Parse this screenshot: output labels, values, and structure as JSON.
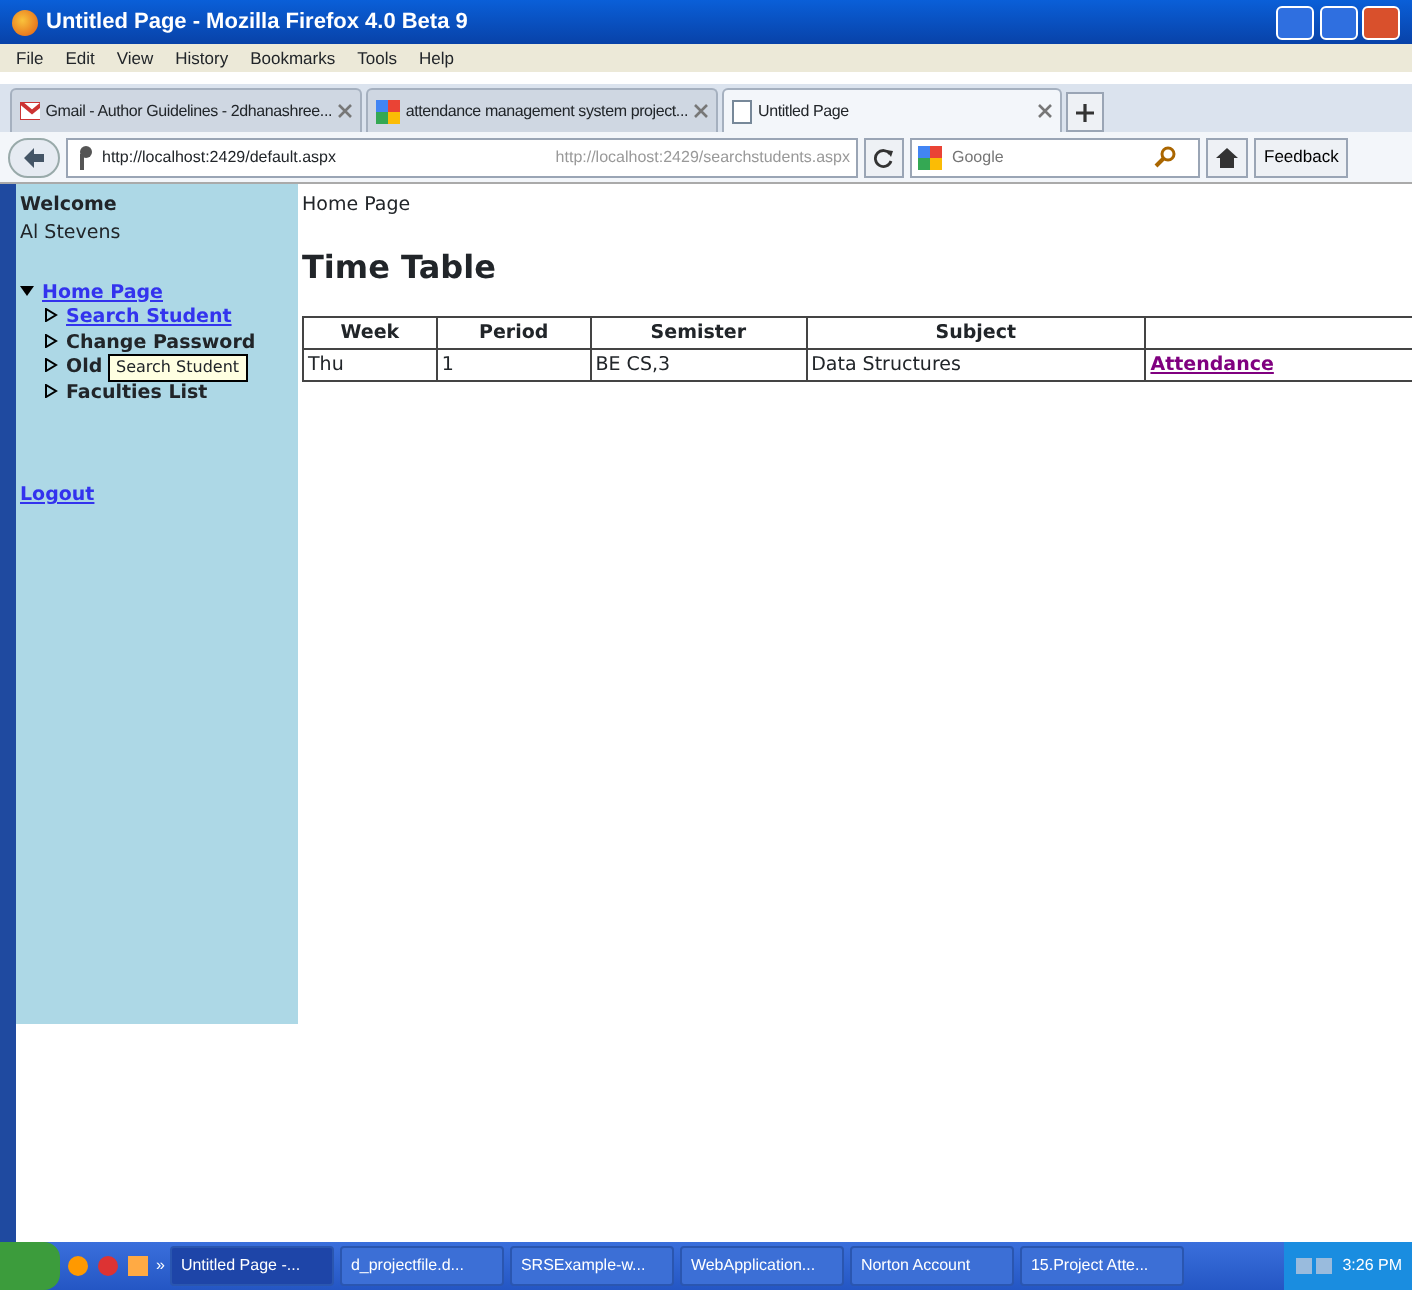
{
  "window": {
    "title": "Untitled Page - Mozilla Firefox 4.0 Beta 9"
  },
  "menu": [
    "File",
    "Edit",
    "View",
    "History",
    "Bookmarks",
    "Tools",
    "Help"
  ],
  "tabs": [
    {
      "label": "Gmail - Author Guidelines - 2dhanashree...",
      "selected": false
    },
    {
      "label": "attendance management system project...",
      "selected": false
    },
    {
      "label": "Untitled Page",
      "selected": true
    }
  ],
  "navbar": {
    "url": "http://localhost:2429/default.aspx",
    "suggestion": "http://localhost:2429/searchstudents.aspx",
    "search": {
      "placeholder": "Google"
    },
    "feedback": "Feedback"
  },
  "sidebar": {
    "welcome": "Welcome",
    "user": "Al Stevens",
    "tree": [
      {
        "label": "Home Page",
        "kind": "link",
        "expanded": true,
        "children": [
          {
            "label": "Search Student",
            "kind": "link",
            "expanded": false
          },
          {
            "label": "Change Password",
            "kind": "plain",
            "expanded": false
          },
          {
            "label": "Old",
            "kind": "plain",
            "expanded": false
          },
          {
            "label": "Faculties List",
            "kind": "plain",
            "expanded": false
          }
        ]
      }
    ],
    "logout": "Logout",
    "tooltip": "Search Student"
  },
  "content": {
    "breadcrumb": "Home Page",
    "heading": "Time Table",
    "table": {
      "columns": [
        "Week",
        "Period",
        "Semister",
        "Subject",
        ""
      ],
      "rows": [
        [
          "Thu",
          "1",
          "BE CS,3",
          "Data Structures",
          "Attendance"
        ]
      ]
    }
  },
  "taskbar": {
    "items": [
      {
        "label": "Untitled Page -...",
        "selected": true
      },
      {
        "label": "d_projectfile.d...",
        "selected": false
      },
      {
        "label": "SRSExample-w...",
        "selected": false
      },
      {
        "label": "WebApplication...",
        "selected": false
      },
      {
        "label": "Norton Account",
        "selected": false
      },
      {
        "label": "15.Project Atte...",
        "selected": false
      }
    ],
    "chevron": "»",
    "clock": "3:26 PM"
  }
}
